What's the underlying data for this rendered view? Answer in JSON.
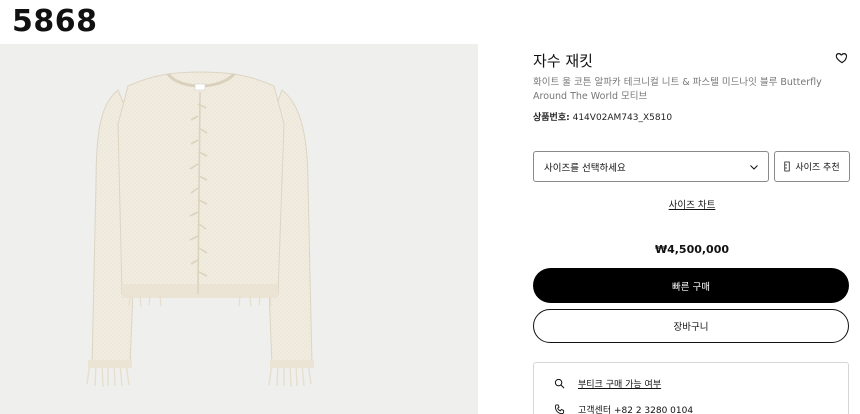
{
  "code_label": "5868",
  "product": {
    "title": "자수 재킷",
    "subtitle": "화이트 울 코튼 알파카 테크니컬 니트 & 파스텔 미드나잇 블루 Butterfly Around The World 모티브",
    "sku_label": "상품번호:",
    "sku_value": "414V02AM743_X5810",
    "price": "₩4,500,000"
  },
  "size": {
    "select_placeholder": "사이즈를 선택하세요",
    "recommend_label": "사이즈 추천",
    "chart_link": "사이즈 차트"
  },
  "actions": {
    "buy_now": "빠른 구매",
    "add_to_cart": "장바구니"
  },
  "services": {
    "boutique_availability": "부티크 구매 가능 여부",
    "customer_center": "고객센터 +82 2 3280 0104"
  },
  "icons": {
    "wishlist": "heart-icon",
    "dropdown": "chevron-down-icon",
    "size_recommend": "ruler-icon",
    "search": "search-icon",
    "phone": "phone-icon"
  },
  "colors": {
    "primary_button_bg": "#000000",
    "primary_button_text": "#ffffff",
    "image_bg": "#efefee",
    "garment": "#f1ece0"
  }
}
